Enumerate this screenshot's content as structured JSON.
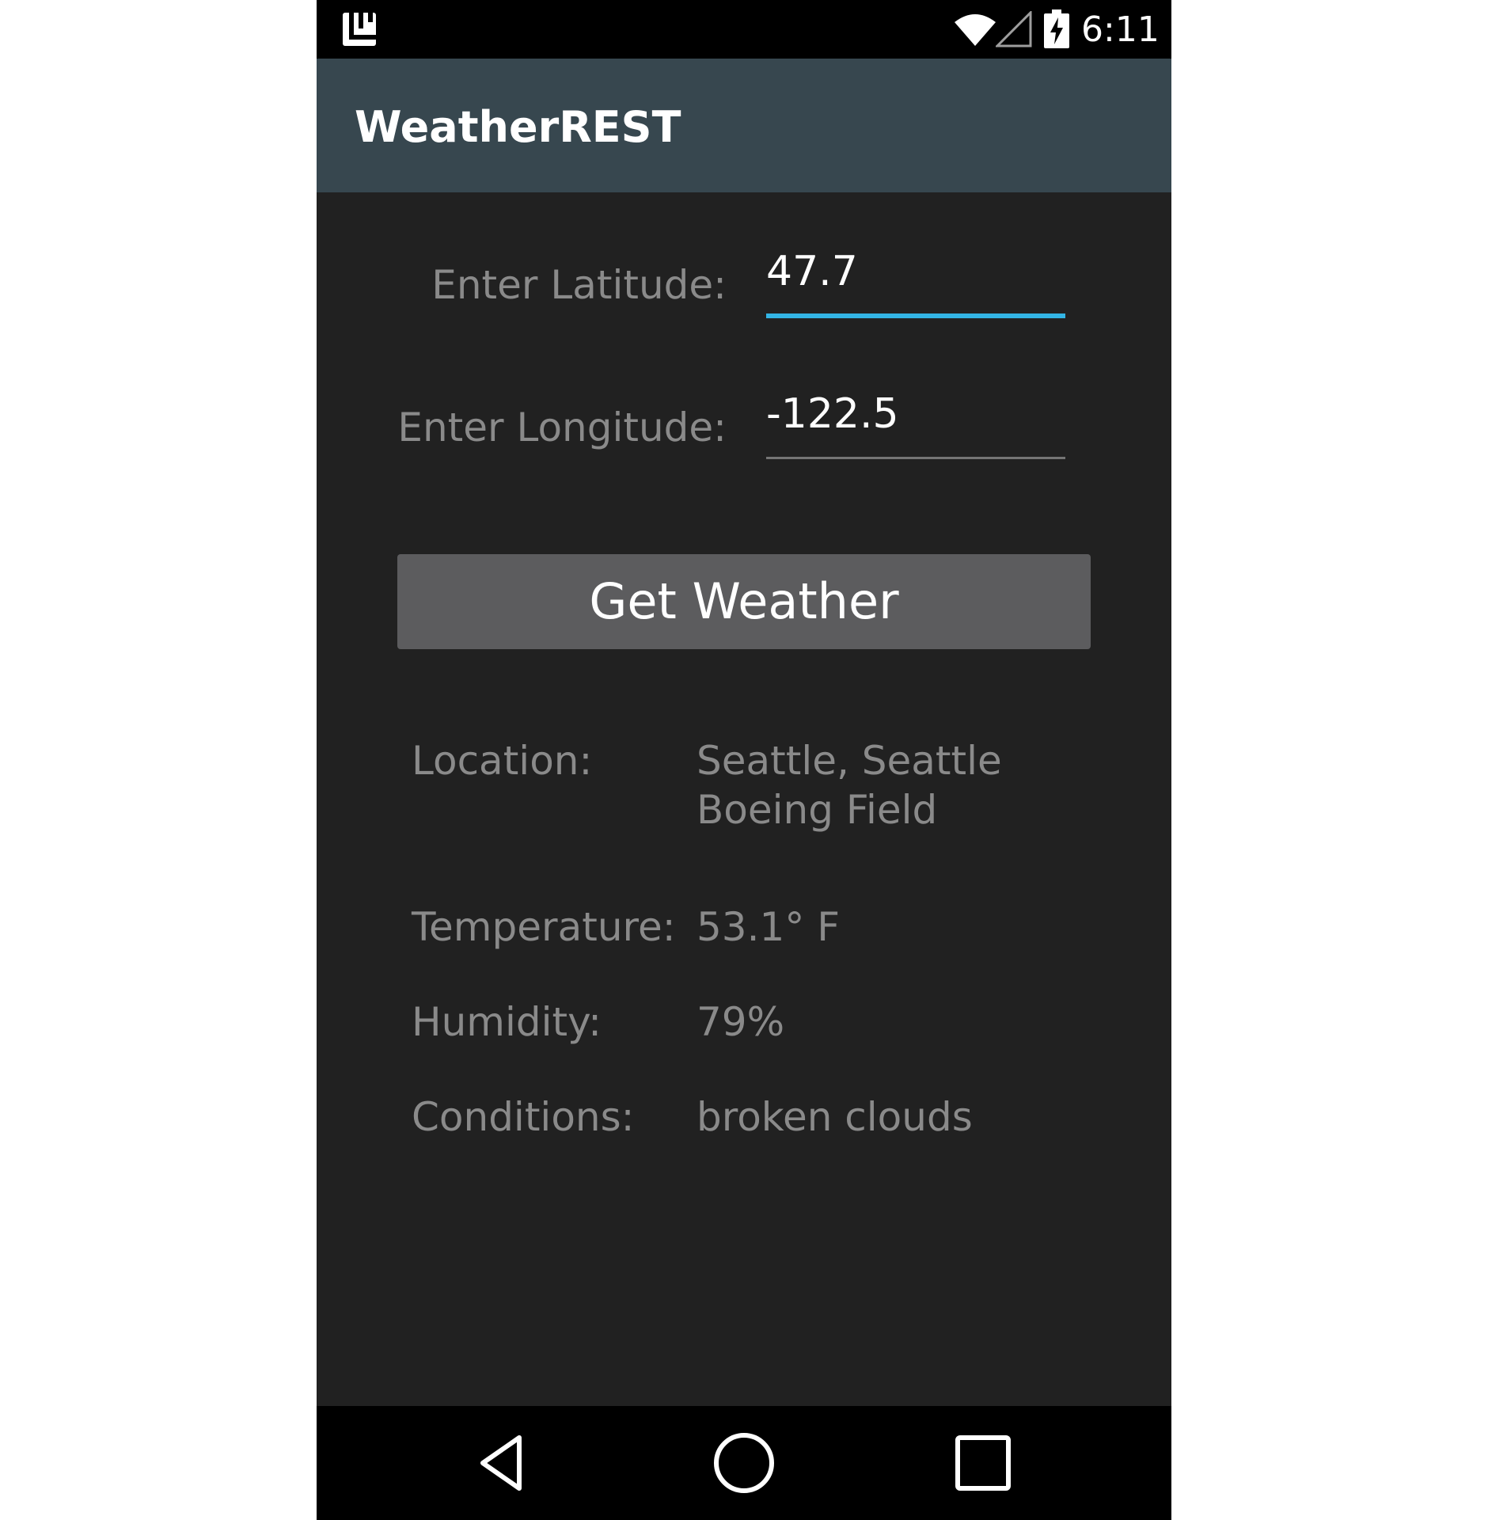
{
  "status_bar": {
    "time": "6:11",
    "icons": [
      "notification-launcher-icon",
      "wifi-icon",
      "cell-signal-icon",
      "battery-charging-icon"
    ]
  },
  "app_bar": {
    "title": "WeatherREST"
  },
  "form": {
    "latitude_label": "Enter Latitude:",
    "latitude_value": "47.7",
    "longitude_label": "Enter Longitude:",
    "longitude_value": "-122.5",
    "button_label": "Get Weather"
  },
  "results": {
    "location_label": "Location:",
    "location_value": "Seattle, Seattle Boeing Field",
    "temperature_label": "Temperature:",
    "temperature_value": "53.1° F",
    "humidity_label": "Humidity:",
    "humidity_value": "79%",
    "conditions_label": "Conditions:",
    "conditions_value": "broken clouds"
  },
  "nav_bar": {
    "icons": [
      "back-icon",
      "home-icon",
      "recents-icon"
    ]
  },
  "colors": {
    "app_bar": "#37474f",
    "background": "#212121",
    "accent": "#33b5e5",
    "button": "#5c5c5e",
    "label_text": "#8a8a8a"
  }
}
